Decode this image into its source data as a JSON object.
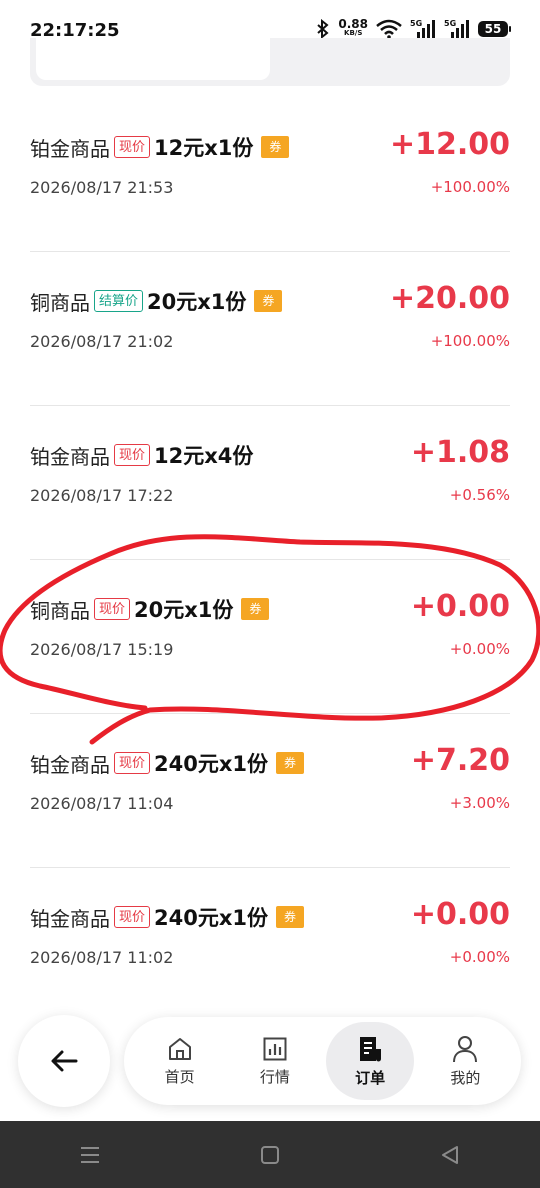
{
  "status_bar": {
    "time": "22:17:25",
    "net_speed_value": "0.88",
    "net_speed_unit": "KB/S",
    "signal1_label": "5G",
    "signal2_label": "5G",
    "battery": "55",
    "icons": [
      "bluetooth-icon",
      "wifi-icon",
      "signal-icon",
      "signal-icon",
      "battery-icon"
    ]
  },
  "orders": [
    {
      "name": "铂金商品",
      "tag": "现价",
      "tag_style": "red",
      "spec": "12元x1份",
      "coupon": "券",
      "date": "2026/08/17 21:53",
      "profit": "+12.00",
      "percent": "+100.00%"
    },
    {
      "name": "铜商品",
      "tag": "结算价",
      "tag_style": "green",
      "spec": "20元x1份",
      "coupon": "券",
      "date": "2026/08/17 21:02",
      "profit": "+20.00",
      "percent": "+100.00%"
    },
    {
      "name": "铂金商品",
      "tag": "现价",
      "tag_style": "red",
      "spec": "12元x4份",
      "coupon": "",
      "date": "2026/08/17 17:22",
      "profit": "+1.08",
      "percent": "+0.56%"
    },
    {
      "name": "铜商品",
      "tag": "现价",
      "tag_style": "red",
      "spec": "20元x1份",
      "coupon": "券",
      "date": "2026/08/17 15:19",
      "profit": "+0.00",
      "percent": "+0.00%"
    },
    {
      "name": "铂金商品",
      "tag": "现价",
      "tag_style": "red",
      "spec": "240元x1份",
      "coupon": "券",
      "date": "2026/08/17 11:04",
      "profit": "+7.20",
      "percent": "+3.00%"
    },
    {
      "name": "铂金商品",
      "tag": "现价",
      "tag_style": "red",
      "spec": "240元x1份",
      "coupon": "券",
      "date": "2026/08/17 11:02",
      "profit": "+0.00",
      "percent": "+0.00%"
    }
  ],
  "nav": {
    "back_icon": "arrow-left-icon",
    "items": [
      {
        "label": "首页",
        "icon": "home-icon"
      },
      {
        "label": "行情",
        "icon": "chart-icon"
      },
      {
        "label": "订单",
        "icon": "order-icon",
        "active": true
      },
      {
        "label": "我的",
        "icon": "user-icon"
      }
    ]
  },
  "colors": {
    "profit_red": "#e8394a",
    "tag_green": "#18a58a",
    "coupon_orange": "#f5a623",
    "annotation_red": "#e8202a"
  }
}
